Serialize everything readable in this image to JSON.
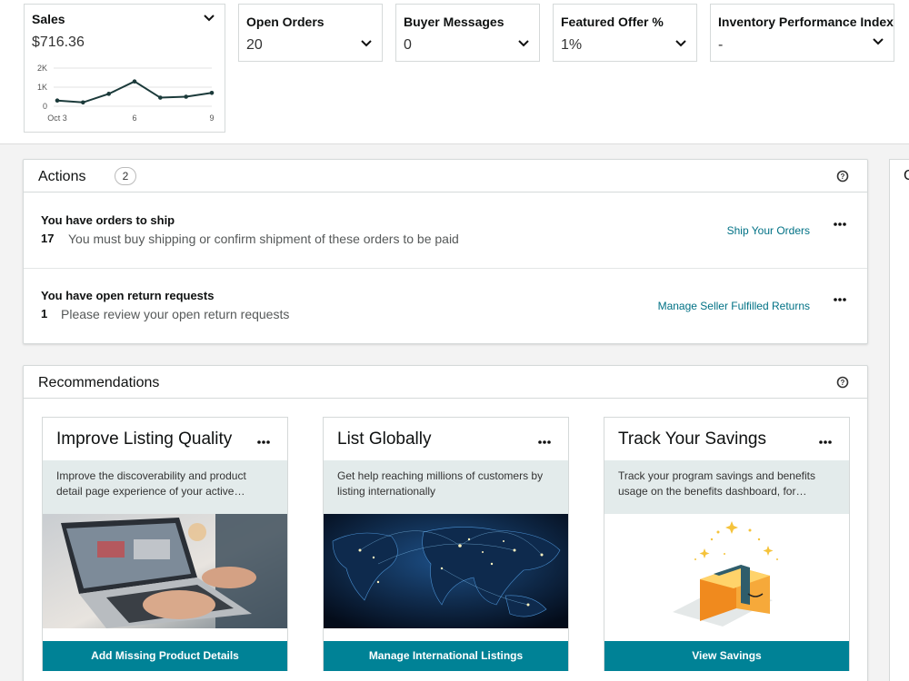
{
  "metrics": {
    "sales": {
      "title": "Sales",
      "value": "$716.36",
      "y_tick_labels": [
        "2K",
        "1K",
        "0"
      ],
      "x_tick_labels": [
        "Oct 3",
        "6",
        "9"
      ]
    },
    "open_orders": {
      "title": "Open Orders",
      "value": "20"
    },
    "buyer_messages": {
      "title": "Buyer Messages",
      "value": "0"
    },
    "featured_offer": {
      "title": "Featured Offer %",
      "value": "1%"
    },
    "inventory_performance": {
      "title": "Inventory Performance Index",
      "value": "-"
    }
  },
  "chart_data": {
    "type": "line",
    "title": "Sales",
    "x": [
      "Oct 3",
      "Oct 4",
      "Oct 5",
      "Oct 6",
      "Oct 7",
      "Oct 8",
      "Oct 9"
    ],
    "values": [
      300,
      200,
      650,
      1300,
      450,
      500,
      700
    ],
    "ylim": [
      0,
      2000
    ],
    "y_ticks": [
      "0",
      "1K",
      "2K"
    ],
    "x_ticks": [
      "Oct 3",
      "6",
      "9"
    ],
    "grid": true,
    "color": "#1b3a3a"
  },
  "actions": {
    "title": "Actions",
    "count": "2",
    "items": [
      {
        "title": "You have orders to ship",
        "count": "17",
        "text": "You must buy shipping or confirm shipment of these orders to be paid",
        "link": "Ship Your Orders"
      },
      {
        "title": "You have open return requests",
        "count": "1",
        "text": "Please review your open return requests",
        "link": "Manage Seller Fulfilled Returns"
      }
    ]
  },
  "recommendations": {
    "title": "Recommendations",
    "cards": [
      {
        "title": "Improve Listing Quality",
        "desc": "Improve the discoverability and product detail page experience of your active…",
        "button": "Add Missing Product Details"
      },
      {
        "title": "List Globally",
        "desc": "Get help reaching millions of customers by listing internationally",
        "button": "Manage International Listings"
      },
      {
        "title": "Track Your Savings",
        "desc": "Track your program savings and benefits usage on the benefits dashboard, for…",
        "button": "View Savings"
      }
    ]
  },
  "right_panel": {
    "title": "C"
  },
  "colors": {
    "accent": "#008296",
    "link": "#007185",
    "desc_bg": "#e3ebeb"
  }
}
